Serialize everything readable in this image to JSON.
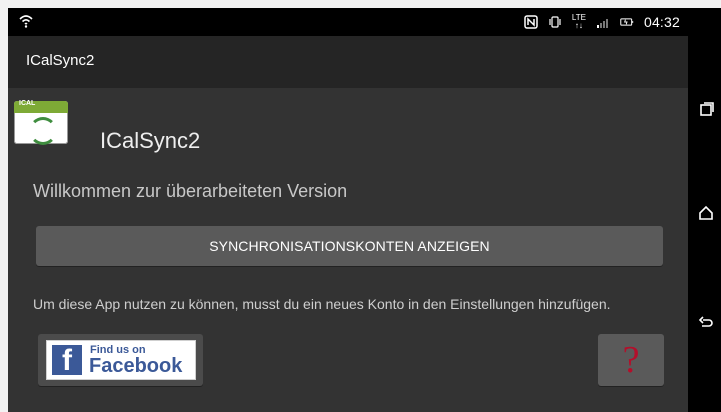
{
  "status_bar": {
    "time": "04:32",
    "icons": [
      "wifi-icon",
      "nfc-icon",
      "vibrate-icon",
      "lte-icon",
      "signal-icon",
      "battery-icon"
    ],
    "lte_label": "LTE"
  },
  "app_bar": {
    "title": "ICalSync2"
  },
  "main": {
    "logo_label": "ICAL",
    "app_name": "ICalSync2",
    "welcome_text": "Willkommen zur überarbeiteten Version",
    "primary_button_label": "SYNCHRONISATIONSKONTEN ANZEIGEN",
    "info_text": "Um diese App nutzen zu können, musst du ein neues Konto in den Einstellungen hinzufügen.",
    "facebook_small": "Find us on",
    "facebook_big": "Facebook",
    "facebook_glyph": "f",
    "help_glyph": "?"
  },
  "colors": {
    "app_bar": "#252525",
    "content_bg": "#333333",
    "button_bg": "#5a5a5a",
    "facebook_blue": "#3b5998",
    "help_red": "#b30f2b"
  }
}
